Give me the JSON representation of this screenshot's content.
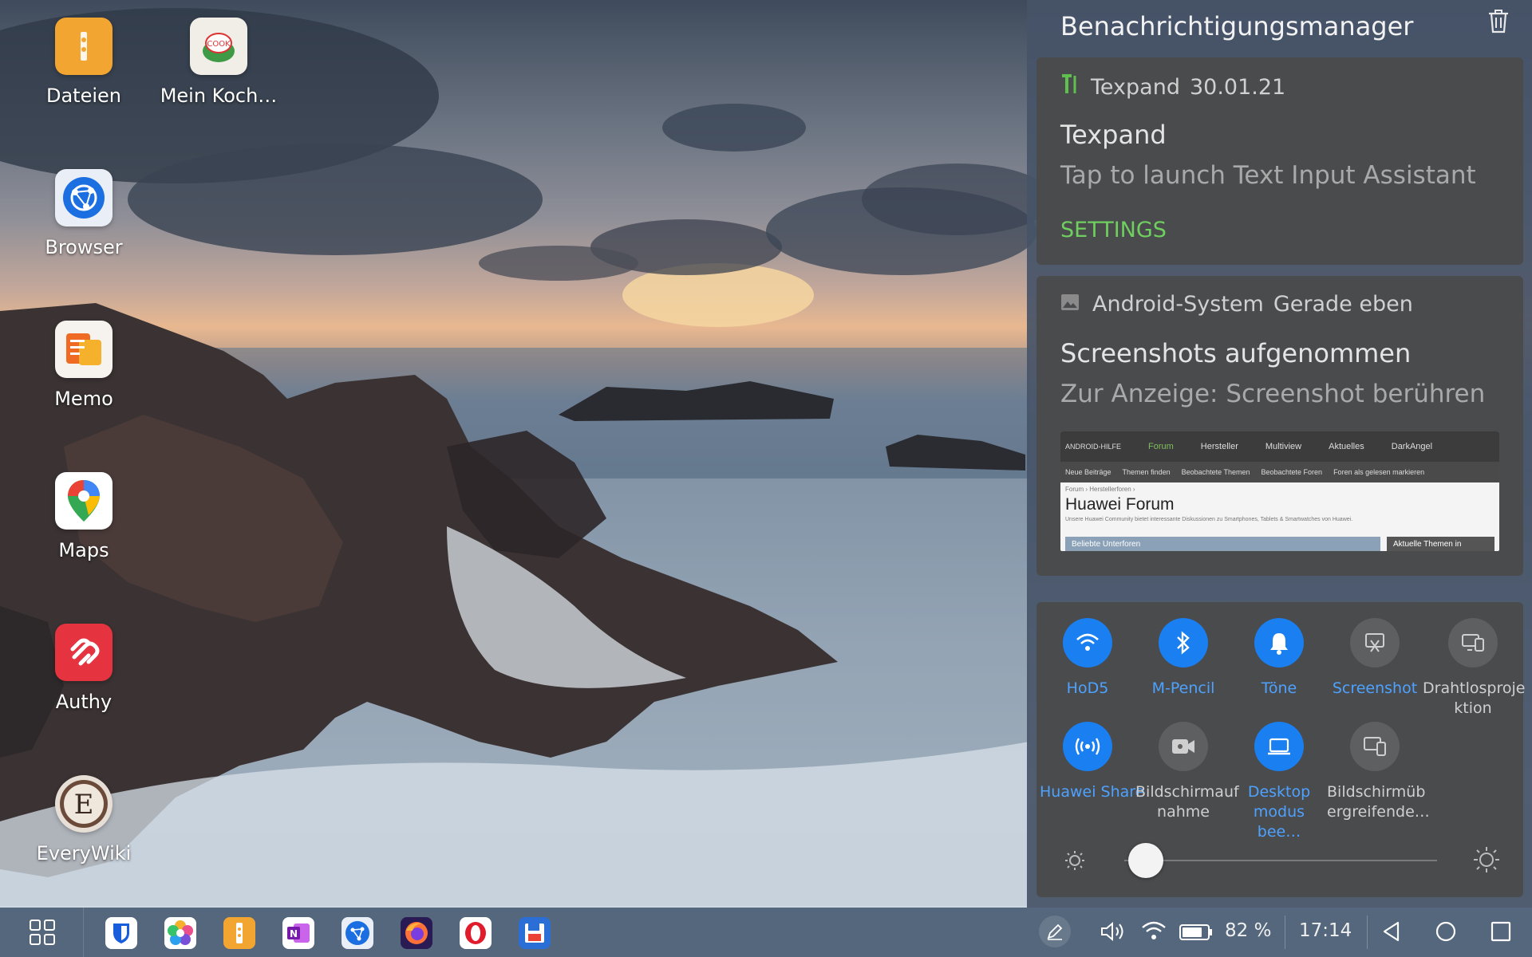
{
  "desktop": {
    "icons": [
      {
        "label": "Dateien",
        "icon": "folder-icon",
        "color": "#f2a530"
      },
      {
        "label": "Mein Koch…",
        "icon": "cookmate-icon",
        "color": "#f0eee6"
      },
      {
        "label": "Browser",
        "icon": "browser-globe-icon",
        "color": "#1b6fe0"
      },
      {
        "label": "Memo",
        "icon": "memo-icon",
        "color": "#ef8a22"
      },
      {
        "label": "Maps",
        "icon": "maps-pin-icon",
        "color": "#ffffff"
      },
      {
        "label": "Authy",
        "icon": "authy-icon",
        "color": "#e5343f"
      },
      {
        "label": "EveryWiki",
        "icon": "everywiki-icon",
        "color": "#6b4a3a"
      }
    ]
  },
  "panel": {
    "title": "Benachrichtigungsmanager",
    "notifications": [
      {
        "app": "Texpand",
        "time": "30.01.21",
        "title": "Texpand",
        "body": "Tap to launch Text Input Assistant",
        "action": "SETTINGS"
      },
      {
        "app": "Android-System",
        "time": "Gerade eben",
        "title": "Screenshots aufgenommen",
        "body": "Zur Anzeige: Screenshot berühren",
        "preview": {
          "logo": "ANDROID-HILFE",
          "nav": [
            "Forum",
            "Hersteller",
            "Multiview",
            "Aktuelles",
            "DarkAngel"
          ],
          "subnav": [
            "Neue Beiträge",
            "Themen finden",
            "Beobachtete Themen",
            "Beobachtete Foren",
            "Foren als gelesen markieren"
          ],
          "breadcrumb": "Forum › Herstellerforen ›",
          "heading": "Huawei Forum",
          "description": "Unsere Huawei Community bietet interessante Diskussionen zu Smartphones, Tablets & Smartwatches von Huawei.",
          "tab_left": "Beliebte Unterforen",
          "tab_right": "Aktuelle Themen in"
        }
      }
    ],
    "quick_settings": [
      {
        "label": "HoD5",
        "icon": "wifi-icon",
        "on": true
      },
      {
        "label": "M-Pencil",
        "icon": "bluetooth-icon",
        "on": true
      },
      {
        "label": "Töne",
        "icon": "bell-icon",
        "on": true
      },
      {
        "label": "Screenshot",
        "icon": "screenshot-icon",
        "on": false,
        "accent_label": true
      },
      {
        "label": "Drahtlosproje\nktion",
        "icon": "wireless-projection-icon",
        "on": false
      },
      {
        "label": "Huawei Share",
        "icon": "huawei-share-icon",
        "on": true
      },
      {
        "label": "Bildschirmauf\nnahme",
        "icon": "screen-record-icon",
        "on": false
      },
      {
        "label": "Desktop\nmodus bee…",
        "icon": "desktop-mode-icon",
        "on": true
      },
      {
        "label": "Bildschirmüb\nergreifende…",
        "icon": "multi-screen-icon",
        "on": false
      }
    ],
    "brightness": 0.07
  },
  "taskbar": {
    "apps": [
      "bitwarden-icon",
      "photos-icon",
      "files-icon",
      "onenote-icon",
      "browser-icon",
      "firefox-icon",
      "opera-icon",
      "save-icon"
    ],
    "battery": "82 %",
    "time": "17:14"
  },
  "colors": {
    "accent": "#1a7ff0",
    "settings_green": "#6fcf5f",
    "panel_bg": "#465468",
    "card_bg": "#4a4b4d",
    "taskbar_bg": "#54677c"
  }
}
